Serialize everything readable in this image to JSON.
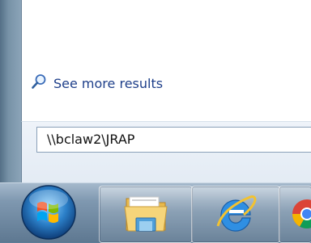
{
  "start_menu": {
    "see_more_results_label": "See more results",
    "search_value": "\\\\bclaw2\\JRAP"
  },
  "taskbar": {
    "items": [
      {
        "name": "start-button",
        "icon": "windows-orb-icon"
      },
      {
        "name": "windows-explorer",
        "icon": "folder-icon"
      },
      {
        "name": "internet-explorer",
        "icon": "internet-explorer-icon"
      },
      {
        "name": "chrome",
        "icon": "chrome-icon"
      }
    ]
  }
}
